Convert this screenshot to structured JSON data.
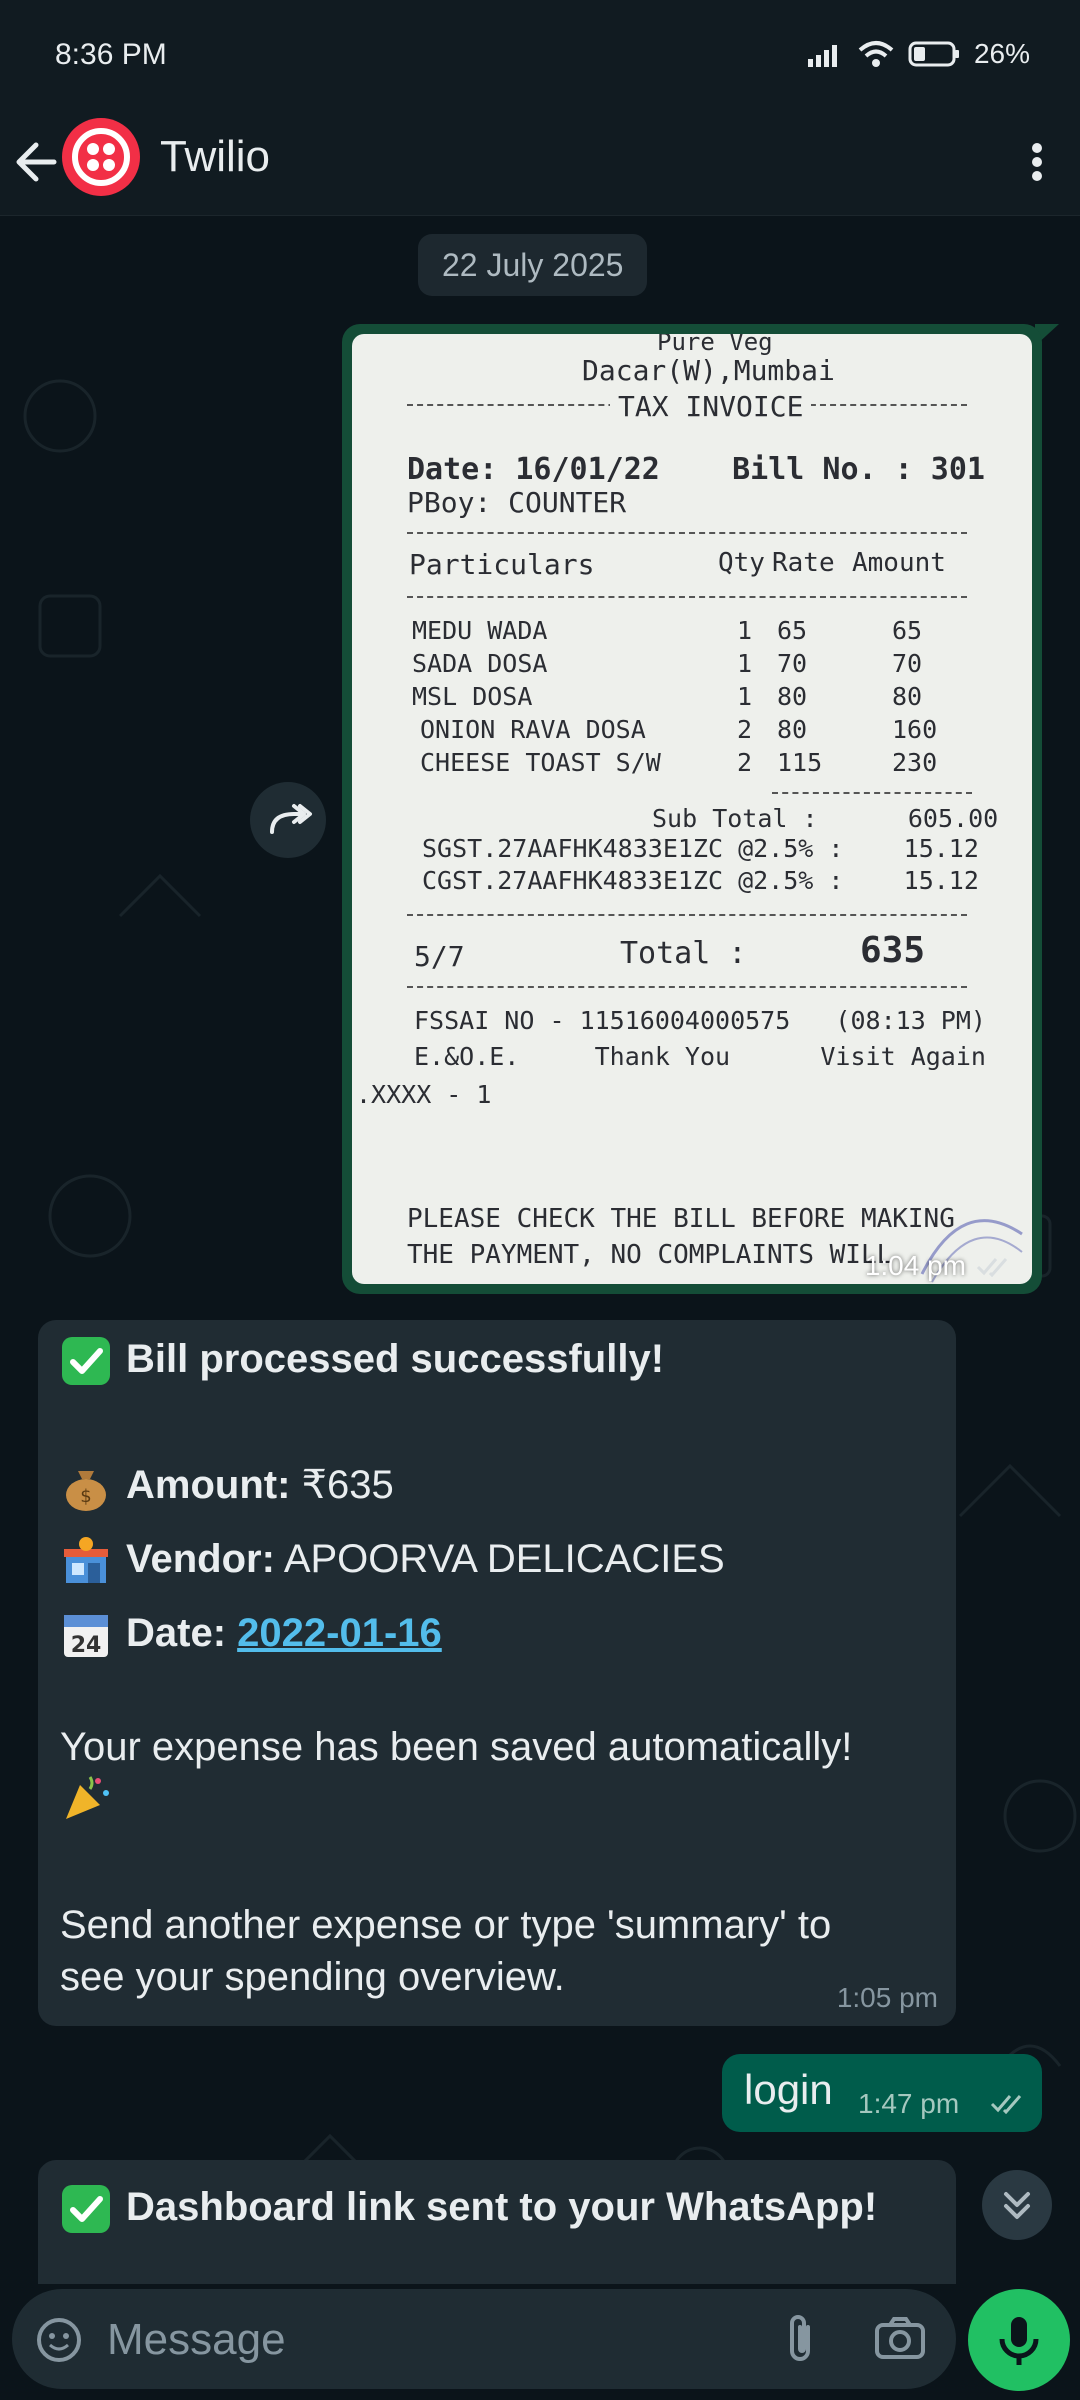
{
  "status_bar": {
    "time": "8:36 PM",
    "battery": "26%"
  },
  "header": {
    "contact_name": "Twilio",
    "back_icon": "arrow-left-icon",
    "menu_icon": "more-vertical-icon"
  },
  "chat": {
    "date_separator": "22 July 2025",
    "receipt_message": {
      "time": "1:04 pm",
      "receipt_lines": {
        "l1": "Pure Veg",
        "l2": "Dacar(W),Mumbai",
        "l3": "TAX INVOICE",
        "l4": "Date: 16/01/22    Bill No. : 301",
        "l5": "PBoy: COUNTER",
        "h_particulars": "Particulars",
        "h_qty": "Qty",
        "h_rate": "Rate",
        "h_amount": "Amount",
        "items": [
          {
            "name": "MEDU WADA",
            "qty": "1",
            "rate": "65",
            "amount": "65"
          },
          {
            "name": "SADA DOSA",
            "qty": "1",
            "rate": "70",
            "amount": "70"
          },
          {
            "name": "MSL DOSA",
            "qty": "1",
            "rate": "80",
            "amount": "80"
          },
          {
            "name": "ONION RAVA DOSA",
            "qty": "2",
            "rate": "80",
            "amount": "160"
          },
          {
            "name": "CHEESE TOAST S/W",
            "qty": "2",
            "rate": "115",
            "amount": "230"
          }
        ],
        "subtotal": "Sub Total :      605.00",
        "sgst": "SGST.27AAFHK4833E1ZC @2.5% :    15.12",
        "cgst": "CGST.27AAFHK4833E1ZC @2.5% :    15.12",
        "total_left": "5/7",
        "total_label": "Total :",
        "total_value": "635",
        "fssai": "FSSAI NO - 11516004000575   (08:13 PM)",
        "thanks": "E.&O.E.     Thank You      Visit Again",
        "xxxx": ".XXXX - 1",
        "footer1": "PLEASE CHECK THE BILL BEFORE MAKING",
        "footer2": "THE PAYMENT, NO COMPLAINTS WILL"
      }
    },
    "bot_reply": {
      "line_processed": "Bill processed successfully!",
      "amount_label": "Amount:",
      "amount_value": "₹635",
      "vendor_label": "Vendor:",
      "vendor_value": "APOORVA DELICACIES",
      "date_label": "Date:",
      "date_value": "2022-01-16",
      "saved_text": "Your expense has been saved automatically!",
      "send_text_1": "Send another expense or type 'summary' to",
      "send_text_2": "see your spending overview.",
      "time": "1:05 pm"
    },
    "user_login": {
      "text": "login",
      "time": "1:47 pm"
    },
    "bot_dashboard": {
      "text": "Dashboard link sent to your WhatsApp!"
    }
  },
  "composer": {
    "placeholder": "Message"
  },
  "colors": {
    "accent": "#21c063",
    "outgoing": "#005c4b",
    "incoming": "#202c33",
    "link": "#53bdeb",
    "brand": "#f22f46"
  }
}
